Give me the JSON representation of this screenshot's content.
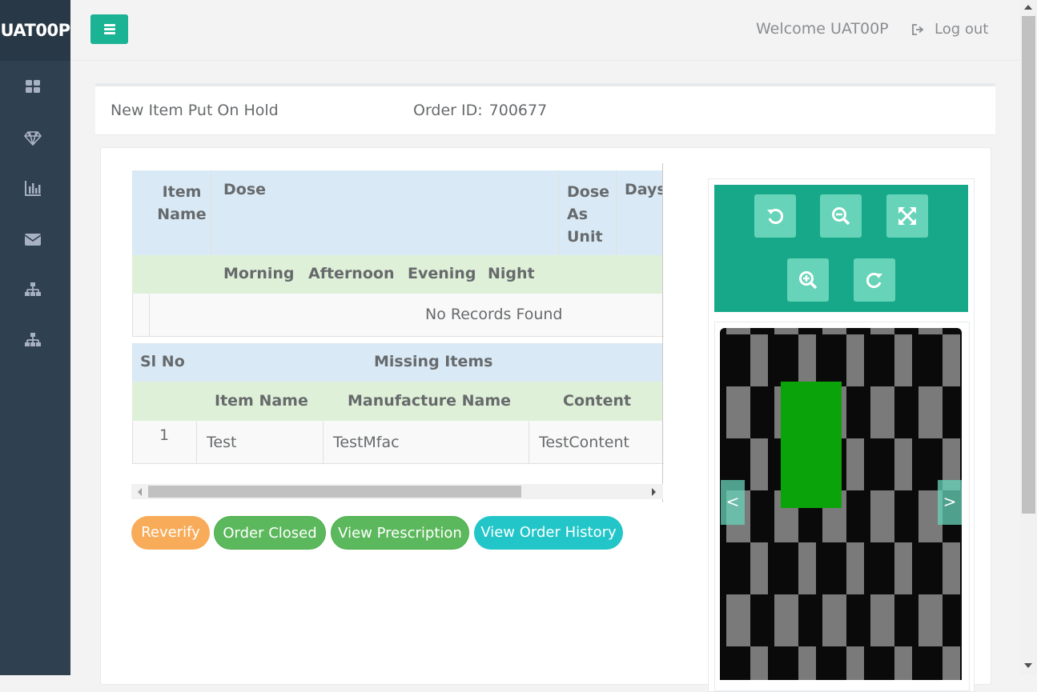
{
  "app": {
    "brand": "UAT00P",
    "welcome": "Welcome UAT00P",
    "logout_label": "Log out"
  },
  "sidebar": {
    "icons": [
      "dashboard-icon",
      "diamond-icon",
      "bar-chart-icon",
      "envelope-icon",
      "sitemap-icon",
      "sitemap-icon"
    ]
  },
  "header": {
    "title": "New Item Put On Hold",
    "order_label": "Order ID:",
    "order_id": "700677"
  },
  "dose_table": {
    "headers": [
      "Item Name",
      "Dose",
      "Dose As Unit",
      "Days"
    ],
    "sub_headers": [
      "Morning",
      "Afternoon",
      "Evening",
      "Night"
    ],
    "empty_text": "No Records Found"
  },
  "missing_table": {
    "headers": [
      "Sl No",
      "Missing Items"
    ],
    "sub_headers": [
      "Item Name",
      "Manufacture Name",
      "Content"
    ],
    "rows": [
      {
        "sl": "1",
        "item_name": "Test",
        "manufacture_name": "TestMfac",
        "content": "TestContent"
      }
    ]
  },
  "actions": {
    "reverify": "Reverify",
    "order_closed": "Order Closed",
    "view_prescription": "View Prescription",
    "view_order_history": "View Order History"
  },
  "viewer": {
    "tools": [
      "rotate-left-icon",
      "zoom-out-icon",
      "fullscreen-icon",
      "zoom-in-icon",
      "rotate-right-icon"
    ],
    "prev": "<",
    "next": ">"
  },
  "colors": {
    "sidebar": "#2f4050",
    "brand_bg": "#293846",
    "primary": "#1ab394",
    "reverify": "#f8ac59",
    "success": "#5cb85c",
    "info": "#23c6c8"
  }
}
